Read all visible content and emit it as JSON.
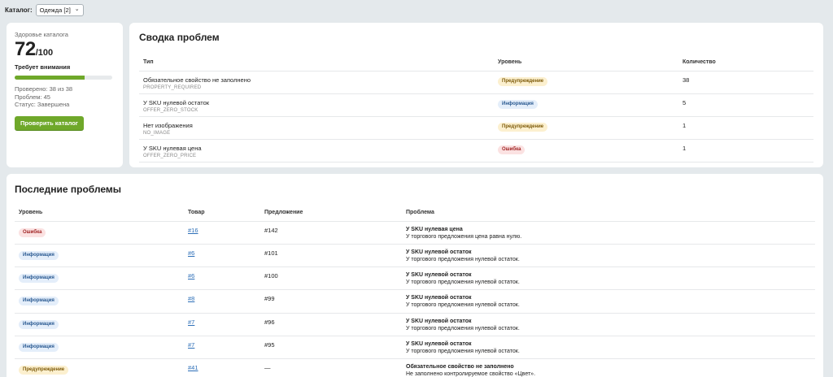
{
  "catalog": {
    "label": "Каталог:",
    "selected": "Одежда [2]"
  },
  "health": {
    "caption": "Здоровье каталога",
    "score": "72",
    "score_max": "/100",
    "status_label": "Требует внимания",
    "progress_percent": 72,
    "stats": [
      "Проверено: 38 из 38",
      "Проблем: 45",
      "Статус: Завершена"
    ],
    "button_label": "Проверить каталог",
    "accent_color": "#6fa82a"
  },
  "summary": {
    "title": "Сводка проблем",
    "headers": {
      "type": "Тип",
      "level": "Уровень",
      "count": "Количество"
    },
    "rows": [
      {
        "name": "Обязательное свойство не заполнено",
        "code": "PROPERTY_REQUIRED",
        "level": "Предупреждение",
        "level_kind": "warn",
        "count": "38"
      },
      {
        "name": "У SKU нулевой остаток",
        "code": "OFFER_ZERO_STOCK",
        "level": "Информация",
        "level_kind": "info",
        "count": "5"
      },
      {
        "name": "Нет изображения",
        "code": "NO_IMAGE",
        "level": "Предупреждение",
        "level_kind": "warn",
        "count": "1"
      },
      {
        "name": "У SKU нулевая цена",
        "code": "OFFER_ZERO_PRICE",
        "level": "Ошибка",
        "level_kind": "err",
        "count": "1"
      }
    ]
  },
  "recent": {
    "title": "Последние проблемы",
    "headers": {
      "level": "Уровень",
      "product": "Товар",
      "offer": "Предложение",
      "problem": "Проблема"
    },
    "rows": [
      {
        "level": "Ошибка",
        "level_kind": "err",
        "product": "#16",
        "offer": "#142",
        "problem_title": "У SKU нулевая цена",
        "problem_desc": "У торгового предложения цена равна нулю."
      },
      {
        "level": "Информация",
        "level_kind": "info",
        "product": "#6",
        "offer": "#101",
        "problem_title": "У SKU нулевой остаток",
        "problem_desc": "У торгового предложения нулевой остаток."
      },
      {
        "level": "Информация",
        "level_kind": "info",
        "product": "#6",
        "offer": "#100",
        "problem_title": "У SKU нулевой остаток",
        "problem_desc": "У торгового предложения нулевой остаток."
      },
      {
        "level": "Информация",
        "level_kind": "info",
        "product": "#8",
        "offer": "#99",
        "problem_title": "У SKU нулевой остаток",
        "problem_desc": "У торгового предложения нулевой остаток."
      },
      {
        "level": "Информация",
        "level_kind": "info",
        "product": "#7",
        "offer": "#96",
        "problem_title": "У SKU нулевой остаток",
        "problem_desc": "У торгового предложения нулевой остаток."
      },
      {
        "level": "Информация",
        "level_kind": "info",
        "product": "#7",
        "offer": "#95",
        "problem_title": "У SKU нулевой остаток",
        "problem_desc": "У торгового предложения нулевой остаток."
      },
      {
        "level": "Предупреждение",
        "level_kind": "warn",
        "product": "#41",
        "offer": "—",
        "problem_title": "Обязательное свойство не заполнено",
        "problem_desc": "Не заполнено контролируемое свойство «Цвет»."
      }
    ]
  },
  "colors": {
    "warn_bg": "#fcf0cf",
    "info_bg": "#e4eefa",
    "err_bg": "#fbe2e2",
    "link": "#2d6fb8"
  }
}
